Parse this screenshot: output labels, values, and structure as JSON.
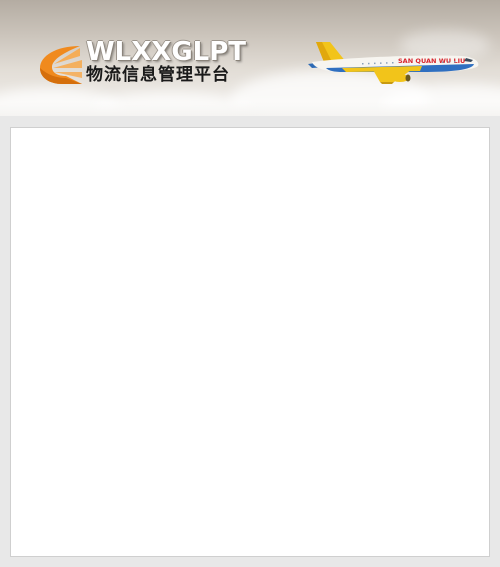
{
  "header": {
    "logo_latin": "WLXXGLPT",
    "logo_cn": "物流信息管理平台",
    "airplane_livery": "SAN QUAN WU LIU"
  },
  "colors": {
    "page_background": "#e8e8e8",
    "panel_background": "#ffffff",
    "logo_orange": "#f08a1e",
    "plane_yellow": "#f2c41a",
    "plane_livery_red": "#d8262e"
  },
  "icons": {
    "logo": "orange-fan-logo-icon",
    "plane": "cargo-airplane-icon"
  },
  "main": {
    "panel": "blank content panel"
  }
}
